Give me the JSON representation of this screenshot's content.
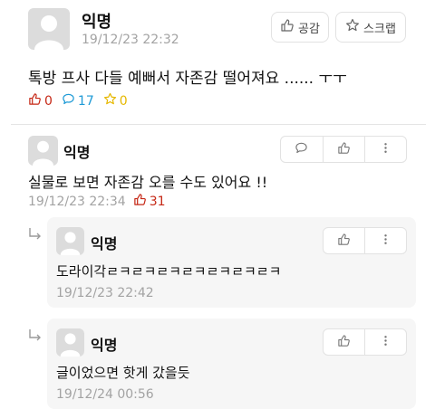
{
  "post": {
    "author": "익명",
    "date": "19/12/23 22:32",
    "like_button": "공감",
    "scrap_button": "스크랩",
    "body": "톡방 프사 다들 예뻐서 자존감 떨어져요 ...... ㅜㅜ",
    "stats": {
      "likes": "0",
      "comments": "17",
      "scraps": "0"
    }
  },
  "comment": {
    "author": "익명",
    "body": "실물로 보면 자존감 오를 수도 있어요 !!",
    "date": "19/12/23 22:34",
    "votes": "31"
  },
  "replies": [
    {
      "author": "익명",
      "body": "도라이각ㄹㅋㄹㅋㄹㅋㄹㅋㄹㅋㄹㅋㄹㅋ",
      "date": "19/12/23 22:42"
    },
    {
      "author": "익명",
      "body": "글이었으면 핫게 갔을듯",
      "date": "19/12/24 00:56"
    }
  ],
  "icons": {
    "thumbs_up": "thumbs-up-icon",
    "comment": "speech-bubble-icon",
    "star": "star-icon",
    "more": "vertical-ellipsis-icon",
    "reply": "reply-arrow-icon"
  },
  "colors": {
    "like_red": "#c62917",
    "comment_blue": "#1e9ad6",
    "scrap_yellow": "#e6b800",
    "meta_gray": "#a3a3a3",
    "reply_bg": "#f6f6f6"
  }
}
